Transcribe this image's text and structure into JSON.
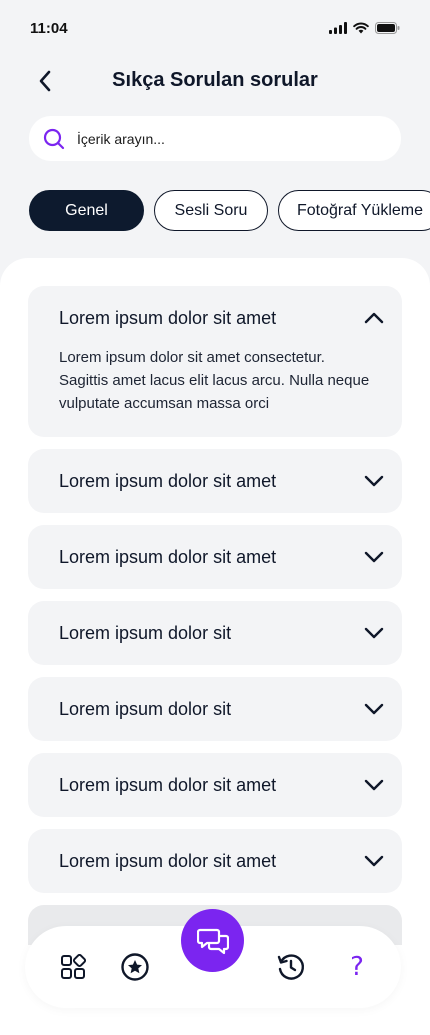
{
  "status_bar": {
    "time": "11:04"
  },
  "header": {
    "title": "Sıkça Sorulan sorular"
  },
  "search": {
    "placeholder": "İçerik arayın..."
  },
  "chips": [
    {
      "label": "Genel",
      "active": true
    },
    {
      "label": "Sesli Soru",
      "active": false
    },
    {
      "label": "Fotoğraf Yükleme",
      "active": false
    }
  ],
  "faq": [
    {
      "question": "Lorem ipsum dolor sit amet",
      "answer": "Lorem ipsum dolor sit amet consectetur. Sagittis amet lacus elit lacus arcu. Nulla neque vulputate accumsan massa orci",
      "expanded": true
    },
    {
      "question": "Lorem ipsum dolor sit amet",
      "expanded": false
    },
    {
      "question": "Lorem ipsum dolor sit amet",
      "expanded": false
    },
    {
      "question": "Lorem ipsum dolor sit",
      "expanded": false
    },
    {
      "question": "Lorem ipsum dolor sit",
      "expanded": false
    },
    {
      "question": "Lorem ipsum dolor sit amet",
      "expanded": false
    },
    {
      "question": "Lorem ipsum dolor sit amet",
      "expanded": false
    }
  ],
  "bottom_nav": {
    "items": [
      "grid-icon",
      "star-icon",
      "chat-icon",
      "history-icon",
      "help-icon"
    ],
    "help_glyph": "?"
  },
  "colors": {
    "accent": "#7b25f0",
    "dark": "#0d1a2e",
    "card": "#f3f4f6"
  }
}
